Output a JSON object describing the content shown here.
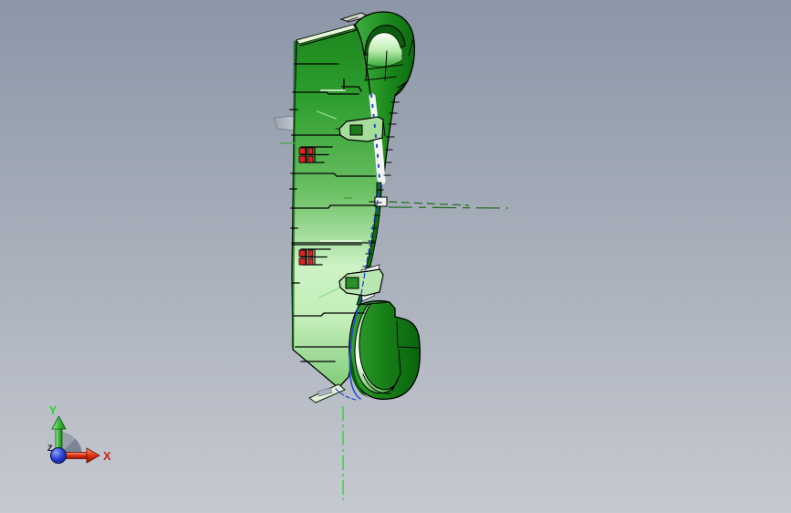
{
  "viewport": {
    "description": "CAD 3D viewport showing a green wheel-cover part in side view",
    "background_top": "#8b96a7",
    "background_bottom": "#c6c9d0"
  },
  "model": {
    "name": "wheel-cover-part",
    "body_color": "#2fa12f",
    "body_color_dark": "#0d6e10",
    "body_color_light": "#cdf2c4",
    "edge_color": "#000000",
    "face_highlight_color": "#f3f7f3",
    "clip_color": "#dd2222",
    "selected_edge_color": "#2244dd"
  },
  "annotations": {
    "centerline_color": "#33cc33",
    "axis_line_color": "#3fae3f",
    "hidden_line_color": "#1a6b1a"
  },
  "axis_triad": {
    "x_label": "X",
    "y_label": "Y",
    "z_label": "Z",
    "x_color": "#cc2222",
    "y_color": "#2dd22d",
    "z_color": "#14142a",
    "origin_color": "#2a3fd4"
  }
}
